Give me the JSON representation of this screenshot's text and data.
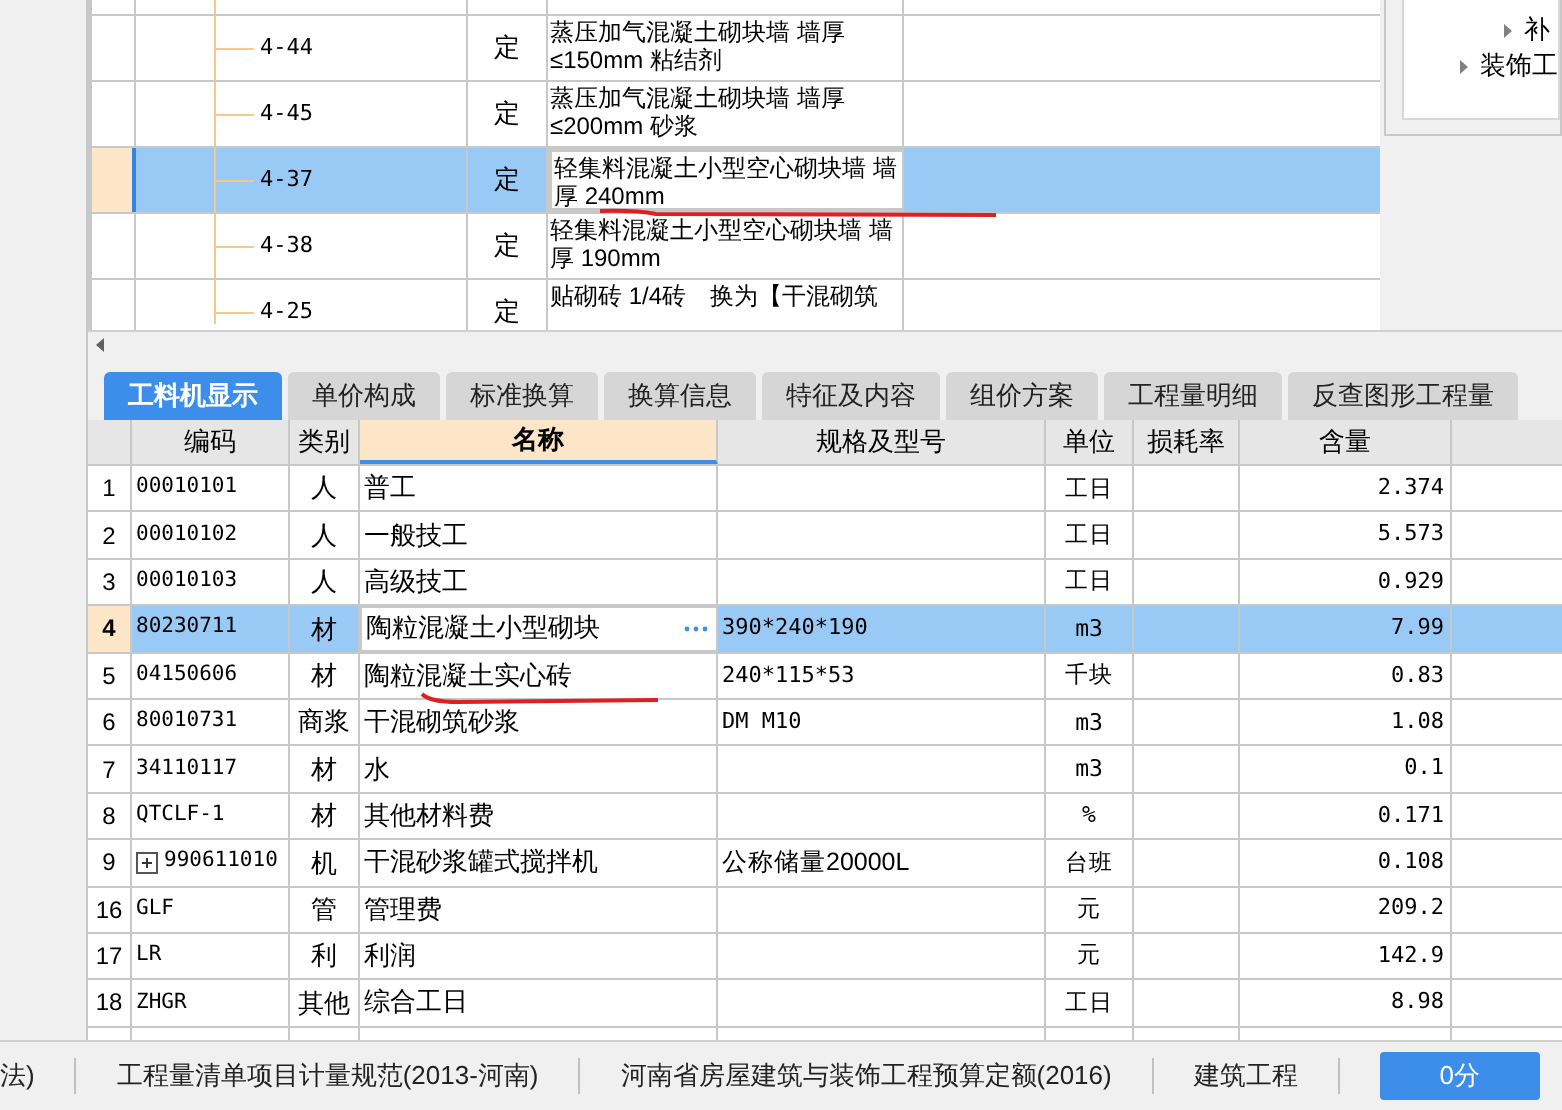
{
  "quota_grid": {
    "rows": [
      {
        "code": "4-44",
        "type": "定",
        "name": "蒸压加气混凝土砌块墙 墙厚≤150mm 粘结剂",
        "selected": false
      },
      {
        "code": "4-45",
        "type": "定",
        "name": "蒸压加气混凝土砌块墙 墙厚≤200mm 砂浆",
        "selected": false
      },
      {
        "code": "4-37",
        "type": "定",
        "name": "轻集料混凝土小型空心砌块墙 墙厚 240mm",
        "selected": true
      },
      {
        "code": "4-38",
        "type": "定",
        "name": "轻集料混凝土小型空心砌块墙 墙厚 190mm",
        "selected": false
      },
      {
        "code": "4-25",
        "type": "定",
        "name": "贴砌砖 1/4砖　换为【干混砌筑",
        "selected": false
      }
    ]
  },
  "library_tree": {
    "items": [
      {
        "label": "补",
        "expanded": false
      },
      {
        "label": "装饰工",
        "expanded": false
      }
    ]
  },
  "tabs": [
    {
      "label": "工料机显示",
      "selected": true
    },
    {
      "label": "单价构成",
      "selected": false
    },
    {
      "label": "标准换算",
      "selected": false
    },
    {
      "label": "换算信息",
      "selected": false
    },
    {
      "label": "特征及内容",
      "selected": false
    },
    {
      "label": "组价方案",
      "selected": false
    },
    {
      "label": "工程量明细",
      "selected": false
    },
    {
      "label": "反查图形工程量",
      "selected": false
    }
  ],
  "materials_table": {
    "columns": [
      "编码",
      "类别",
      "名称",
      "规格及型号",
      "单位",
      "损耗率",
      "含量"
    ],
    "rows": [
      {
        "no": "1",
        "code": "00010101",
        "category": "人",
        "name": "普工",
        "unit": "工日",
        "qty": "2.374",
        "selected": false
      },
      {
        "no": "2",
        "code": "00010102",
        "category": "人",
        "name": "一般技工",
        "unit": "工日",
        "qty": "5.573",
        "selected": false
      },
      {
        "no": "3",
        "code": "00010103",
        "category": "人",
        "name": "高级技工",
        "unit": "工日",
        "qty": "0.929",
        "selected": false
      },
      {
        "no": "4",
        "code": "80230711",
        "category": "材",
        "name": "陶粒混凝土小型砌块",
        "spec": "390*240*190",
        "unit": "m3",
        "qty": "7.99",
        "selected": true
      },
      {
        "no": "5",
        "code": "04150606",
        "category": "材",
        "name": "陶粒混凝土实心砖",
        "spec": "240*115*53",
        "unit": "千块",
        "qty": "0.83",
        "selected": false
      },
      {
        "no": "6",
        "code": "80010731",
        "category": "商浆",
        "name": "干混砌筑砂浆",
        "spec": "DM M10",
        "unit": "m3",
        "qty": "1.08",
        "selected": false
      },
      {
        "no": "7",
        "code": "34110117",
        "category": "材",
        "name": "水",
        "unit": "m3",
        "qty": "0.1",
        "selected": false
      },
      {
        "no": "8",
        "code": "QTCLF-1",
        "category": "材",
        "name": "其他材料费",
        "unit": "%",
        "qty": "0.171",
        "selected": false
      },
      {
        "no": "9",
        "code": "990611010",
        "category": "机",
        "name": "干混砂浆罐式搅拌机",
        "spec": "公称储量20000L",
        "unit": "台班",
        "qty": "0.108",
        "selected": false,
        "expanded": false
      },
      {
        "no": "16",
        "code": "GLF",
        "category": "管",
        "name": "管理费",
        "unit": "元",
        "qty": "209.2",
        "selected": false
      },
      {
        "no": "17",
        "code": "LR",
        "category": "利",
        "name": "利润",
        "unit": "元",
        "qty": "142.9",
        "selected": false
      },
      {
        "no": "18",
        "code": "ZHGR",
        "category": "其他",
        "name": "综合工日",
        "unit": "工日",
        "qty": "8.98",
        "selected": false
      }
    ]
  },
  "status_bar": {
    "items": [
      "法)",
      "工程量清单项目计量规范(2013-河南)",
      "河南省房屋建筑与装饰工程预算定额(2016)",
      "建筑工程"
    ],
    "score_button": "0分"
  }
}
